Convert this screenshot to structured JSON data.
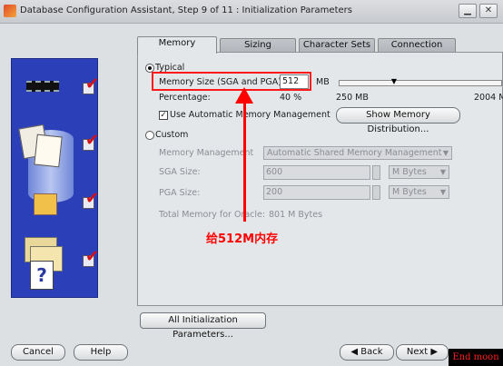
{
  "window": {
    "title": "Database Configuration Assistant, Step 9 of 11 : Initialization Parameters",
    "minimize_glyph": "▁",
    "close_glyph": "✕"
  },
  "tabs": [
    {
      "label": "Memory",
      "active": true
    },
    {
      "label": "Sizing",
      "active": false
    },
    {
      "label": "Character Sets",
      "active": false
    },
    {
      "label": "Connection Mode",
      "active": false
    }
  ],
  "typical": {
    "label": "Typical",
    "selected": true,
    "memory_size_label": "Memory Size (SGA and PGA):",
    "memory_size_value": "512",
    "memory_unit": "MB",
    "percentage_label": "Percentage:",
    "percentage_value": "40 %",
    "slider_min": "250 MB",
    "slider_max": "2004 M",
    "use_amm_label": "Use Automatic Memory Management",
    "use_amm_checked": true,
    "show_distribution_button": "Show Memory Distribution..."
  },
  "custom": {
    "label": "Custom",
    "selected": false,
    "memory_management_label": "Memory Management",
    "memory_management_value": "Automatic Shared Memory Management",
    "sga_size_label": "SGA Size:",
    "sga_size_value": "600",
    "sga_unit": "M Bytes",
    "pga_size_label": "PGA Size:",
    "pga_size_value": "200",
    "pga_unit": "M Bytes",
    "total_memory_label": "Total Memory for Oracle:",
    "total_memory_value": "801 M Bytes"
  },
  "all_params_button": "All Initialization Parameters...",
  "annotation": "给512M内存",
  "footer": {
    "cancel": "Cancel",
    "help": "Help",
    "back": "Back",
    "next": "Next"
  },
  "watermark": "End moon"
}
